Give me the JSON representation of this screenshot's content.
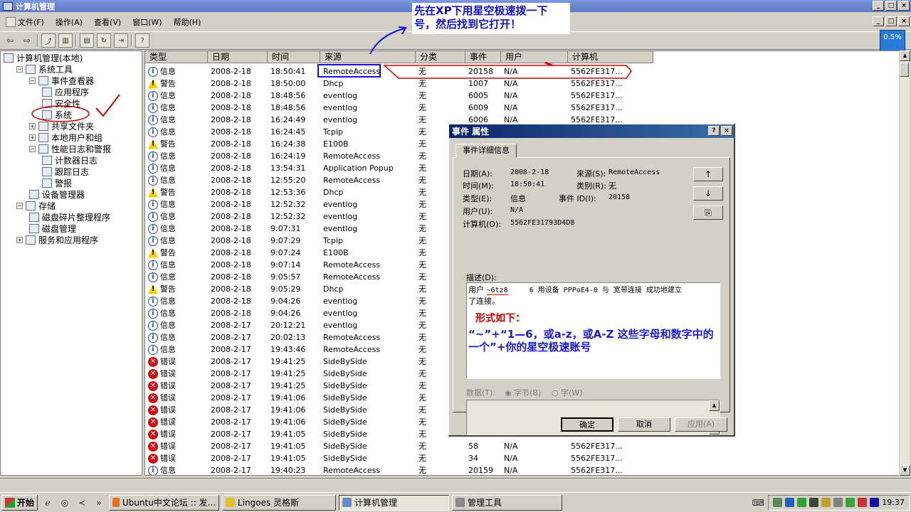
{
  "window": {
    "title": "计算机管理",
    "btn_min": "_",
    "btn_max": "□",
    "btn_close": "×"
  },
  "menu": [
    "文件(F)",
    "操作(A)",
    "查看(V)",
    "窗口(W)",
    "帮助(H)"
  ],
  "mdi": {
    "min": "_",
    "restore": "□",
    "close": "×"
  },
  "tree": [
    {
      "label": "计算机管理(本地)",
      "indent": 0,
      "exp": ""
    },
    {
      "label": "系统工具",
      "indent": 1,
      "exp": "−"
    },
    {
      "label": "事件查看器",
      "indent": 2,
      "exp": "−"
    },
    {
      "label": "应用程序",
      "indent": 3,
      "exp": ""
    },
    {
      "label": "安全性",
      "indent": 3,
      "exp": ""
    },
    {
      "label": "系统",
      "indent": 3,
      "exp": ""
    },
    {
      "label": "共享文件夹",
      "indent": 2,
      "exp": "+"
    },
    {
      "label": "本地用户和组",
      "indent": 2,
      "exp": "+"
    },
    {
      "label": "性能日志和警报",
      "indent": 2,
      "exp": "−"
    },
    {
      "label": "计数器日志",
      "indent": 3,
      "exp": ""
    },
    {
      "label": "跟踪日志",
      "indent": 3,
      "exp": ""
    },
    {
      "label": "警报",
      "indent": 3,
      "exp": ""
    },
    {
      "label": "设备管理器",
      "indent": 2,
      "exp": ""
    },
    {
      "label": "存储",
      "indent": 1,
      "exp": "−"
    },
    {
      "label": "磁盘碎片整理程序",
      "indent": 2,
      "exp": ""
    },
    {
      "label": "磁盘管理",
      "indent": 2,
      "exp": ""
    },
    {
      "label": "服务和应用程序",
      "indent": 1,
      "exp": "+"
    }
  ],
  "columns": [
    "类型",
    "日期",
    "时间",
    "来源",
    "分类",
    "事件",
    "用户",
    "计算机"
  ],
  "rows": [
    [
      "info",
      "信息",
      "2008-2-18",
      "18:50:41",
      "RemoteAccess",
      "无",
      "20158",
      "N/A",
      "5562FE317..."
    ],
    [
      "warn",
      "警告",
      "2008-2-18",
      "18:50:00",
      "Dhcp",
      "无",
      "1007",
      "N/A",
      "5562FE317..."
    ],
    [
      "info",
      "信息",
      "2008-2-18",
      "18:48:56",
      "eventlog",
      "无",
      "6005",
      "N/A",
      "5562FE317..."
    ],
    [
      "info",
      "信息",
      "2008-2-18",
      "18:48:56",
      "eventlog",
      "无",
      "6009",
      "N/A",
      "5562FE317..."
    ],
    [
      "info",
      "信息",
      "2008-2-18",
      "16:24:49",
      "eventlog",
      "无",
      "6006",
      "N/A",
      "5562FE317..."
    ],
    [
      "info",
      "信息",
      "2008-2-18",
      "16:24:45",
      "Tcpip",
      "无",
      "",
      "",
      ""
    ],
    [
      "warn",
      "警告",
      "2008-2-18",
      "16:24:38",
      "E100B",
      "无",
      "",
      "",
      ""
    ],
    [
      "info",
      "信息",
      "2008-2-18",
      "16:24:19",
      "RemoteAccess",
      "无",
      "",
      "",
      ""
    ],
    [
      "info",
      "信息",
      "2008-2-18",
      "13:54:31",
      "Application Popup",
      "无",
      "",
      "",
      ""
    ],
    [
      "info",
      "信息",
      "2008-2-18",
      "12:55:20",
      "RemoteAccess",
      "无",
      "",
      "",
      ""
    ],
    [
      "warn",
      "警告",
      "2008-2-18",
      "12:53:36",
      "Dhcp",
      "无",
      "",
      "",
      ""
    ],
    [
      "info",
      "信息",
      "2008-2-18",
      "12:52:32",
      "eventlog",
      "无",
      "",
      "",
      ""
    ],
    [
      "info",
      "信息",
      "2008-2-18",
      "12:52:32",
      "eventlog",
      "无",
      "",
      "",
      ""
    ],
    [
      "info",
      "信息",
      "2008-2-18",
      "9:07:31",
      "eventlog",
      "无",
      "",
      "",
      ""
    ],
    [
      "info",
      "信息",
      "2008-2-18",
      "9:07:29",
      "Tcpip",
      "无",
      "",
      "",
      ""
    ],
    [
      "warn",
      "警告",
      "2008-2-18",
      "9:07:24",
      "E100B",
      "无",
      "",
      "",
      ""
    ],
    [
      "info",
      "信息",
      "2008-2-18",
      "9:07:14",
      "RemoteAccess",
      "无",
      "",
      "",
      ""
    ],
    [
      "info",
      "信息",
      "2008-2-18",
      "9:05:57",
      "RemoteAccess",
      "无",
      "",
      "",
      ""
    ],
    [
      "warn",
      "警告",
      "2008-2-18",
      "9:05:29",
      "Dhcp",
      "无",
      "",
      "",
      ""
    ],
    [
      "info",
      "信息",
      "2008-2-18",
      "9:04:26",
      "eventlog",
      "无",
      "",
      "",
      ""
    ],
    [
      "info",
      "信息",
      "2008-2-18",
      "9:04:26",
      "eventlog",
      "无",
      "",
      "",
      ""
    ],
    [
      "info",
      "信息",
      "2008-2-17",
      "20:12:21",
      "eventlog",
      "无",
      "",
      "",
      ""
    ],
    [
      "info",
      "信息",
      "2008-2-17",
      "20:02:13",
      "RemoteAccess",
      "无",
      "",
      "",
      ""
    ],
    [
      "info",
      "信息",
      "2008-2-17",
      "19:43:46",
      "RemoteAccess",
      "无",
      "",
      "",
      ""
    ],
    [
      "err",
      "错误",
      "2008-2-17",
      "19:41:25",
      "SideBySide",
      "无",
      "",
      "",
      ""
    ],
    [
      "err",
      "错误",
      "2008-2-17",
      "19:41:25",
      "SideBySide",
      "无",
      "",
      "",
      ""
    ],
    [
      "err",
      "错误",
      "2008-2-17",
      "19:41:25",
      "SideBySide",
      "无",
      "",
      "",
      ""
    ],
    [
      "err",
      "错误",
      "2008-2-17",
      "19:41:06",
      "SideBySide",
      "无",
      "",
      "",
      ""
    ],
    [
      "err",
      "错误",
      "2008-2-17",
      "19:41:06",
      "SideBySide",
      "无",
      "",
      "",
      ""
    ],
    [
      "err",
      "错误",
      "2008-2-17",
      "19:41:06",
      "SideBySide",
      "无",
      "",
      "",
      ""
    ],
    [
      "err",
      "错误",
      "2008-2-17",
      "19:41:05",
      "SideBySide",
      "无",
      "",
      "",
      ""
    ],
    [
      "err",
      "错误",
      "2008-2-17",
      "19:41:05",
      "SideBySide",
      "无",
      "58",
      "N/A",
      "5562FE317..."
    ],
    [
      "err",
      "错误",
      "2008-2-17",
      "19:41:05",
      "SideBySide",
      "无",
      "34",
      "N/A",
      "5562FE317..."
    ],
    [
      "info",
      "信息",
      "2008-2-17",
      "19:40:23",
      "RemoteAccess",
      "无",
      "20159",
      "N/A",
      "5562FE317..."
    ]
  ],
  "dialog": {
    "title": "事件 属性",
    "help": "?",
    "close": "×",
    "tab": "事件详细信息",
    "date_label": "日期(A):",
    "date": "2008-2-18",
    "source_label": "来源(S):",
    "source": "RemoteAccess",
    "time_label": "时间(M):",
    "time": "18:50:41",
    "category_label": "类别(R):",
    "category": "无",
    "type_label": "类型(E):",
    "type": "信息",
    "eventid_label": "事件 ID(I):",
    "eventid": "20158",
    "user_label": "用户(U):",
    "user": "N/A",
    "computer_label": "计算机(O):",
    "computer": "5562FE31793D4D8",
    "desc_label": "描述(D):",
    "desc_line1a": "用户 ",
    "desc_user": "~6tz8",
    "desc_user_tail": "6",
    "desc_line1b": " 用设备 PPPoE4-0 与 宽带连接  成功地建立",
    "desc_line2": "了连接。",
    "data_label": "数据(T):",
    "radio_bytes": "字节(B)",
    "radio_words": "字(W)",
    "up": "↑",
    "down": "↓",
    "copy": "⎘",
    "ok": "确定",
    "cancel": "取消",
    "apply": "应用(A)"
  },
  "annotations": {
    "note": "先在XP下用星空极速拨一下号，然后找到它打开！",
    "format_title": "形式如下：",
    "format_body": "“~”+“1—6，或a-z，或A-Z  这些字母和数字中的一个”+你的星空极速账号"
  },
  "tray_widget": "0.5%",
  "taskbar": {
    "start": "开始",
    "tasks": [
      "Ubuntu中文论坛 :: 发...",
      "Lingoes 灵格斯",
      "计算机管理",
      "管理工具"
    ],
    "clock": "19:37"
  },
  "colors": {
    "titlebar": "#5b79c6",
    "dialog_title": "#0a246a",
    "annotation_red": "#d00000",
    "annotation_blue": "#1010d0"
  }
}
